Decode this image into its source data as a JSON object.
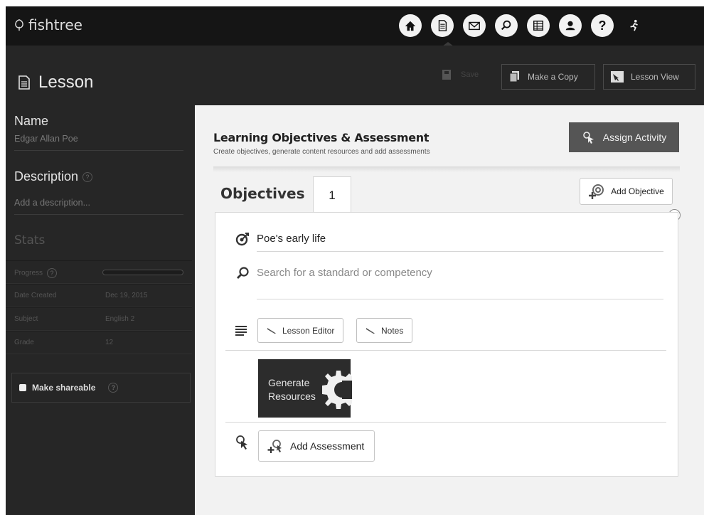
{
  "app": {
    "brand": "fishtree"
  },
  "nav": {
    "items": [
      {
        "name": "home"
      },
      {
        "name": "lesson"
      },
      {
        "name": "messages"
      },
      {
        "name": "search"
      },
      {
        "name": "table"
      },
      {
        "name": "profile"
      },
      {
        "name": "help",
        "glyph": "?"
      },
      {
        "name": "activity"
      }
    ]
  },
  "page": {
    "title": "Lesson"
  },
  "toolbar": {
    "save_label": "Save",
    "copy_label": "Make a Copy",
    "view_label": "Lesson View"
  },
  "sidebar": {
    "name_label": "Name",
    "name_value": "Edgar Allan Poe",
    "description_label": "Description",
    "description_placeholder": "Add a description...",
    "help_glyph": "?",
    "stats_title": "Stats",
    "stats": [
      {
        "key": "Progress",
        "value": ""
      },
      {
        "key": "Date Created",
        "value": "Dec 19, 2015"
      },
      {
        "key": "Subject",
        "value": "English 2"
      },
      {
        "key": "Grade",
        "value": "12"
      }
    ],
    "progress_fraction": 0.0,
    "shareable_label": "Make shareable"
  },
  "panel": {
    "title": "Learning Objectives & Assessment",
    "subtitle": "Create objectives, generate content resources and add assessments",
    "assign_label": "Assign Activity",
    "objectives_label": "Objectives",
    "objectives_count": "1",
    "add_objective_label": "Add Objective",
    "close_glyph": "×",
    "objective_text": "Poe's early life",
    "search_placeholder": "Search for a standard or competency",
    "lesson_editor_label": "Lesson Editor",
    "notes_label": "Notes",
    "generate_line1": "Generate",
    "generate_line2": "Resources",
    "add_assessment_label": "Add Assessment"
  },
  "colors": {
    "topbar": "#151515",
    "page_bg": "#262626",
    "panel_bg": "#f2f2f2",
    "assign_btn": "#555555",
    "generate_tile": "#2c2c2c"
  }
}
